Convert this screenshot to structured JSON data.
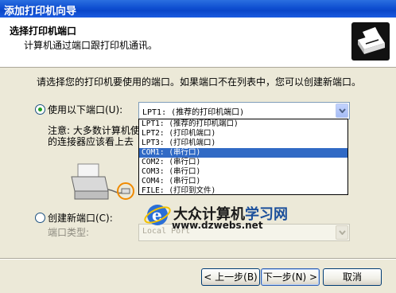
{
  "window": {
    "title": "添加打印机向导"
  },
  "header": {
    "title": "选择打印机端口",
    "subtitle": "计算机通过端口跟打印机通讯。",
    "icon": "printer-icon"
  },
  "intro": "请选择您的打印机要使用的端口。如果端口不在列表中，您可以创建新端口。",
  "port_option": {
    "label": "使用以下端口(U):",
    "selected": true,
    "combo_value": "LPT1: (推荐的打印机端口)",
    "note_line1": "注意: 大多数计算机使",
    "note_line2": "的连接器应该看上去"
  },
  "port_list": {
    "items": [
      "LPT1: (推荐的打印机端口)",
      "LPT2: (打印机端口)",
      "LPT3: (打印机端口)",
      "COM1: (串行口)",
      "COM2: (串行口)",
      "COM3: (串行口)",
      "COM4: (串行口)",
      "FILE: (打印到文件)"
    ],
    "highlighted": "COM1: (串行口)"
  },
  "new_port": {
    "label": "创建新端口(C):",
    "selected": false,
    "type_label": "端口类型:",
    "type_value": "Local Port"
  },
  "watermark": {
    "title_a": "大众计算机",
    "title_b": "学习网",
    "url": "www.dzwebs.net"
  },
  "buttons": {
    "back": "< 上一步(B)",
    "next": "下一步(N) >",
    "cancel": "取消"
  },
  "colors": {
    "titlebar": "#0a46c8",
    "selection": "#316ac5",
    "dialog_bg": "#ece9d8"
  }
}
